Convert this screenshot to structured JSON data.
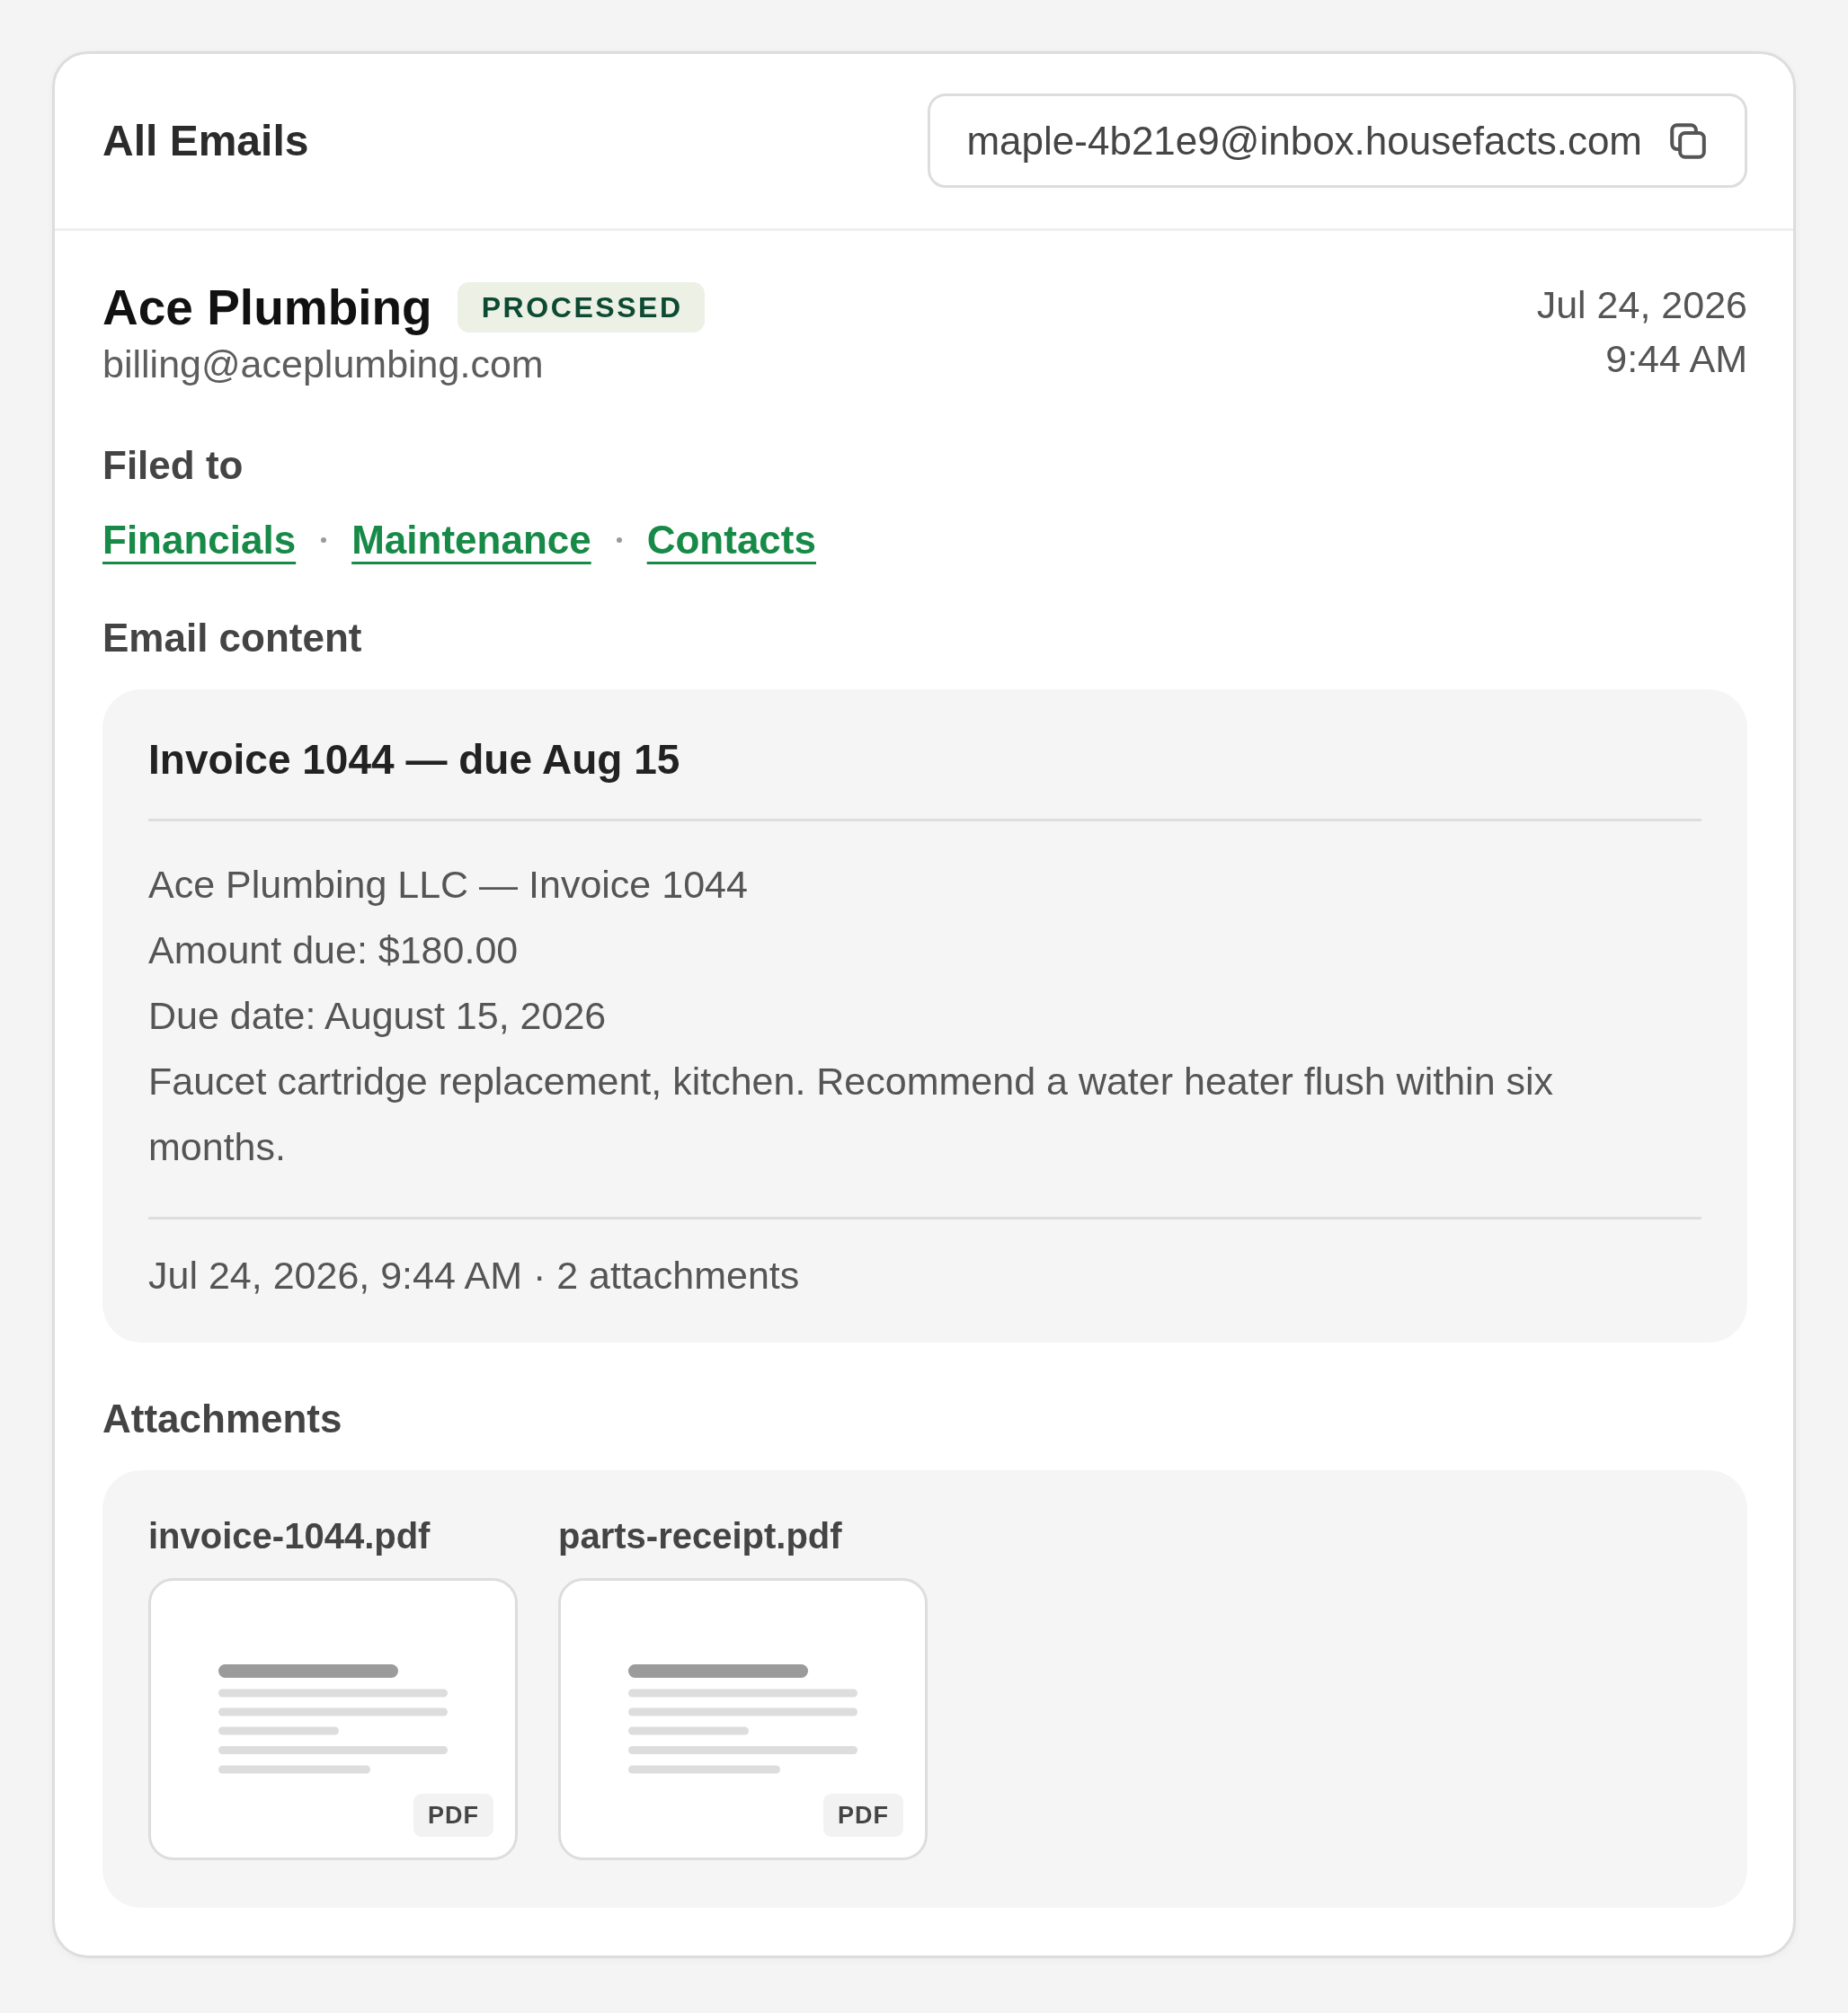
{
  "header": {
    "title": "All Emails",
    "inbox_address": "maple-4b21e9@inbox.housefacts.com"
  },
  "email": {
    "sender_name": "Ace Plumbing",
    "status": {
      "label": "PROCESSED",
      "kind": "processed"
    },
    "sender_address": "billing@aceplumbing.com",
    "date": "Jul 24, 2026",
    "time": "9:44 AM"
  },
  "filed_to": {
    "heading": "Filed to",
    "categories": [
      "Financials",
      "Maintenance",
      "Contacts"
    ]
  },
  "content": {
    "heading": "Email content",
    "subject": "Invoice 1044 — due Aug 15",
    "body": [
      "Ace Plumbing LLC — Invoice 1044",
      "Amount due: $180.00",
      "Due date: August 15, 2026",
      "Faucet cartridge replacement, kitchen. Recommend a water heater flush within six months."
    ],
    "footer": "Jul 24, 2026, 9:44 AM · 2 attachments"
  },
  "attachments": {
    "heading": "Attachments",
    "files": [
      {
        "name": "invoice-1044.pdf",
        "type_label": "PDF"
      },
      {
        "name": "parts-receipt.pdf",
        "type_label": "PDF"
      }
    ]
  }
}
